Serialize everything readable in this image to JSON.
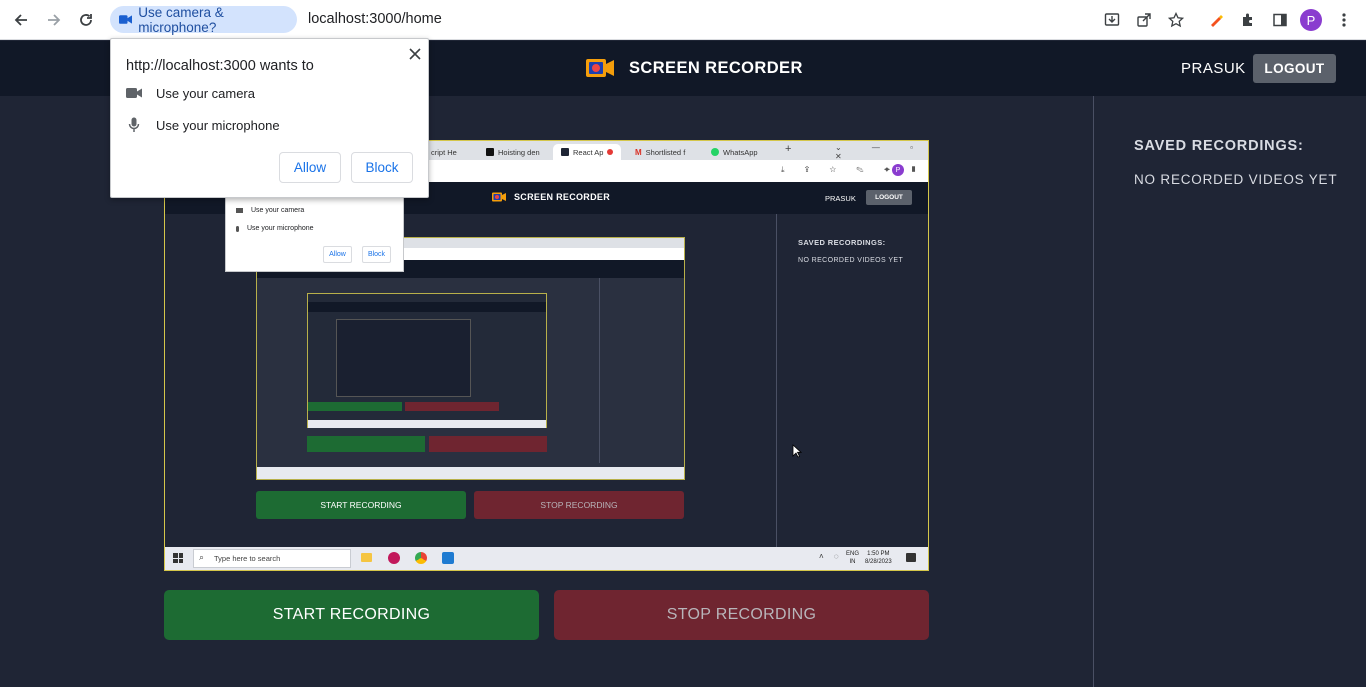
{
  "browser": {
    "permission_chip": "Use camera & microphone?",
    "url": "localhost:3000/home",
    "profile_initial": "P"
  },
  "app": {
    "title": "SCREEN RECORDER",
    "user": "PRASUK",
    "logout_label": "LOGOUT",
    "sidebar_title": "SAVED RECORDINGS:",
    "sidebar_empty": "NO RECORDED VIDEOS YET",
    "start_label": "START RECORDING",
    "stop_label": "STOP RECORDING"
  },
  "popup": {
    "title": "http://localhost:3000 wants to",
    "camera": "Use your camera",
    "microphone": "Use your microphone",
    "allow": "Allow",
    "block": "Block"
  },
  "preview": {
    "tabs": [
      "cript He",
      "Hoisting den",
      "React Ap",
      "Shortlisted f",
      "WhatsApp"
    ],
    "taskbar_search": "Type here to search",
    "lang_line1": "ENG",
    "lang_line2": "IN",
    "clock_time": "1:50 PM",
    "clock_date": "8/28/2023"
  },
  "colors": {
    "accent_blue": "#1a73e8",
    "start_green": "#1d6b33",
    "stop_red": "#6f2530",
    "header_dark": "#111827",
    "body_bg": "#1f2535",
    "logo_orange": "#f59e0b"
  }
}
